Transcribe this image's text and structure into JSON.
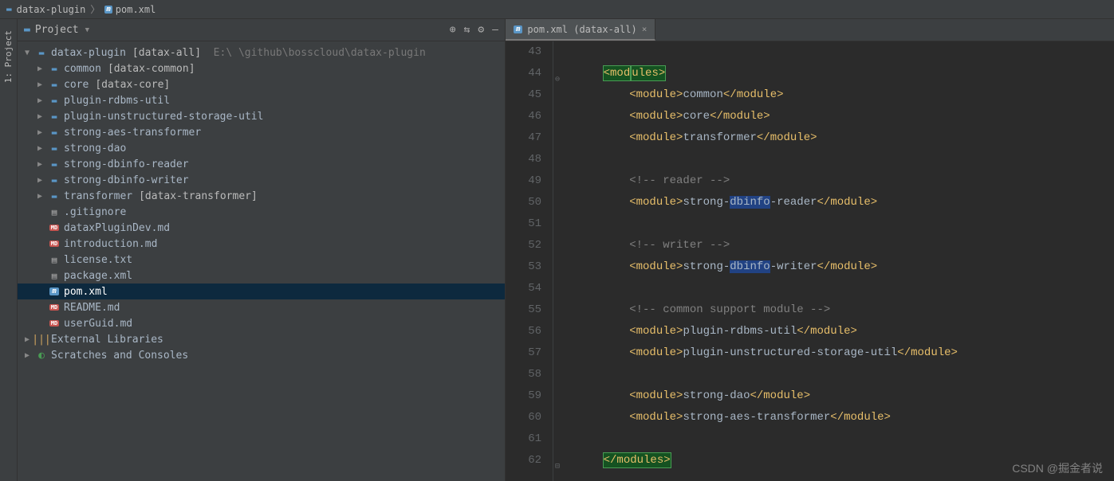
{
  "breadcrumb": {
    "root": "datax-plugin",
    "file": "pom.xml"
  },
  "toolwin": {
    "project": "1: Project"
  },
  "panel": {
    "title": "Project"
  },
  "tree": {
    "root": {
      "name": "datax-plugin",
      "bracket": "[datax-all]",
      "path": "E:\\                        \\github\\bosscloud\\datax-plugin"
    },
    "mods": [
      {
        "name": "common",
        "bracket": "[datax-common]"
      },
      {
        "name": "core",
        "bracket": "[datax-core]"
      },
      {
        "name": "plugin-rdbms-util",
        "bracket": ""
      },
      {
        "name": "plugin-unstructured-storage-util",
        "bracket": ""
      },
      {
        "name": "strong-aes-transformer",
        "bracket": ""
      },
      {
        "name": "strong-dao",
        "bracket": ""
      },
      {
        "name": "strong-dbinfo-reader",
        "bracket": ""
      },
      {
        "name": "strong-dbinfo-writer",
        "bracket": ""
      },
      {
        "name": "transformer",
        "bracket": "[datax-transformer]"
      }
    ],
    "files": [
      {
        "name": ".gitignore",
        "type": "file"
      },
      {
        "name": "dataxPluginDev.md",
        "type": "md"
      },
      {
        "name": "introduction.md",
        "type": "md"
      },
      {
        "name": "license.txt",
        "type": "file"
      },
      {
        "name": "package.xml",
        "type": "file"
      },
      {
        "name": "pom.xml",
        "type": "m",
        "selected": true
      },
      {
        "name": "README.md",
        "type": "md"
      },
      {
        "name": "userGuid.md",
        "type": "md"
      }
    ],
    "extLibs": "External Libraries",
    "scratches": "Scratches and Consoles"
  },
  "editorTab": {
    "label": "pom.xml (datax-all)"
  },
  "code": {
    "startLine": 43,
    "lines": [
      {
        "type": "blank"
      },
      {
        "type": "open",
        "tag": "modules",
        "indent": 1,
        "highlight": true,
        "fold": "open"
      },
      {
        "type": "module",
        "value": "common",
        "indent": 2
      },
      {
        "type": "module",
        "value": "core",
        "indent": 2
      },
      {
        "type": "module",
        "value": "transformer",
        "indent": 2
      },
      {
        "type": "blank"
      },
      {
        "type": "comment",
        "value": "<!-- reader -->",
        "indent": 2
      },
      {
        "type": "module",
        "value": "strong-dbinfo-reader",
        "indent": 2,
        "hlPart": "dbinfo"
      },
      {
        "type": "blank"
      },
      {
        "type": "comment",
        "value": "<!-- writer -->",
        "indent": 2
      },
      {
        "type": "module",
        "value": "strong-dbinfo-writer",
        "indent": 2,
        "hlPart": "dbinfo"
      },
      {
        "type": "blank"
      },
      {
        "type": "comment",
        "value": "<!-- common support module -->",
        "indent": 2
      },
      {
        "type": "module",
        "value": "plugin-rdbms-util",
        "indent": 2
      },
      {
        "type": "module",
        "value": "plugin-unstructured-storage-util",
        "indent": 2
      },
      {
        "type": "blank"
      },
      {
        "type": "module",
        "value": "strong-dao",
        "indent": 2
      },
      {
        "type": "module",
        "value": "strong-aes-transformer",
        "indent": 2
      },
      {
        "type": "blank"
      },
      {
        "type": "close",
        "tag": "modules",
        "indent": 1,
        "highlight": true,
        "fold": "close"
      }
    ]
  },
  "watermark": "CSDN @掘金者说"
}
